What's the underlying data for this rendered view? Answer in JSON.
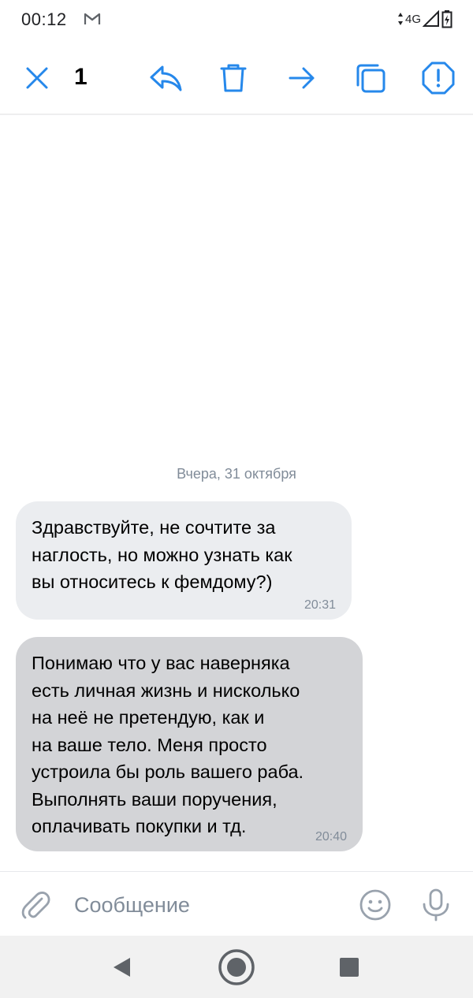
{
  "status_bar": {
    "time": "00:12",
    "network": "4G",
    "icons": [
      "gmail-icon",
      "signal-icon",
      "battery-charging-icon"
    ]
  },
  "action_bar": {
    "selected_count": "1",
    "icons": [
      "close-icon",
      "reply-icon",
      "trash-icon",
      "forward-icon",
      "copy-icon",
      "report-icon"
    ],
    "accent_color": "#2688eb"
  },
  "chat": {
    "date_label": "Вчера, 31 октября",
    "messages": [
      {
        "text": "Здравствуйте, не сочтите за\nнаглость, но можно узнать как\nвы относитесь к фемдому?)",
        "time": "20:31",
        "selected": false
      },
      {
        "text": "Понимаю что у вас наверняка\nесть личная жизнь и нисколько\nна неё не претендую, как и\nна ваше тело. Меня просто\nустроила бы роль вашего раба.\nВыполнять ваши поручения,\nоплачивать покупки и тд.",
        "time": "20:40",
        "selected": true
      }
    ]
  },
  "composer": {
    "placeholder": "Сообщение",
    "value": "",
    "icons": [
      "attach-icon",
      "emoji-icon",
      "microphone-icon"
    ]
  },
  "nav_bar": {
    "icons": [
      "back-icon",
      "home-icon",
      "recents-icon"
    ]
  }
}
